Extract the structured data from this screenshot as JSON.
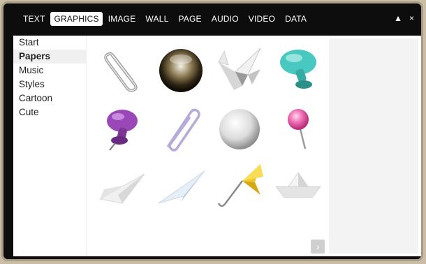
{
  "tabs": [
    {
      "label": "TEXT",
      "active": false
    },
    {
      "label": "GRAPHICS",
      "active": true
    },
    {
      "label": "IMAGE",
      "active": false
    },
    {
      "label": "WALL",
      "active": false
    },
    {
      "label": "PAGE",
      "active": false
    },
    {
      "label": "AUDIO",
      "active": false
    },
    {
      "label": "VIDEO",
      "active": false
    },
    {
      "label": "DATA",
      "active": false
    }
  ],
  "window_controls": {
    "collapse": "▲",
    "close": "×"
  },
  "sidebar": {
    "selected": "Papers",
    "items": [
      {
        "label": "Start"
      },
      {
        "label": "Papers"
      },
      {
        "label": "Music"
      },
      {
        "label": "Styles"
      },
      {
        "label": "Cartoon"
      },
      {
        "label": "Cute"
      }
    ]
  },
  "gallery": {
    "items": [
      {
        "icon": "paperclip-silver-icon"
      },
      {
        "icon": "globe-ball-icon"
      },
      {
        "icon": "origami-crane-icon"
      },
      {
        "icon": "teal-pushpin-icon"
      },
      {
        "icon": "purple-pushpin-icon"
      },
      {
        "icon": "paperclip-lavender-icon"
      },
      {
        "icon": "white-ball-icon"
      },
      {
        "icon": "pink-pin-icon"
      },
      {
        "icon": "paper-plane-white-icon"
      },
      {
        "icon": "paper-plane-blue-icon"
      },
      {
        "icon": "yellow-umbrella-icon"
      },
      {
        "icon": "paper-boat-icon"
      }
    ]
  },
  "next_arrow": "›",
  "colors": {
    "frame": "#0d0d0d",
    "outer": "#c9bda6",
    "tab_active_bg": "#ffffff"
  }
}
